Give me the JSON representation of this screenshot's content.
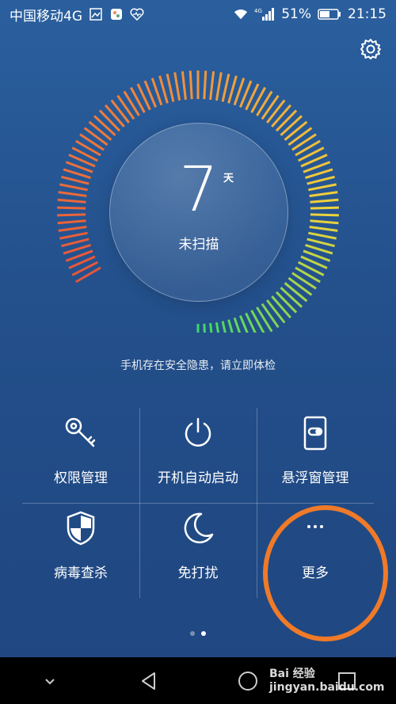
{
  "status_bar": {
    "carrier": "中国移动4G",
    "network": "4G",
    "battery": "51%",
    "time": "21:15"
  },
  "dial": {
    "days": "7",
    "unit": "天",
    "status": "未扫描"
  },
  "tip": "手机存在安全隐患，请立即体检",
  "grid": [
    {
      "label": "权限管理",
      "icon": "key-icon"
    },
    {
      "label": "开机自动启动",
      "icon": "power-icon"
    },
    {
      "label": "悬浮窗管理",
      "icon": "phone-toggle-icon"
    },
    {
      "label": "病毒查杀",
      "icon": "shield-icon"
    },
    {
      "label": "免打扰",
      "icon": "moon-icon"
    },
    {
      "label": "更多",
      "icon": "more-icon"
    }
  ],
  "pager": {
    "pages": 2,
    "active": 2
  },
  "watermark": "Bai 经验 jingyan.baidu.com",
  "colors": {
    "background": "#2a5f9e",
    "highlight_ring": "#f07a28",
    "dial_red": "#e8553a",
    "dial_yellow": "#f0d23a",
    "dial_green": "#3ad86a"
  }
}
